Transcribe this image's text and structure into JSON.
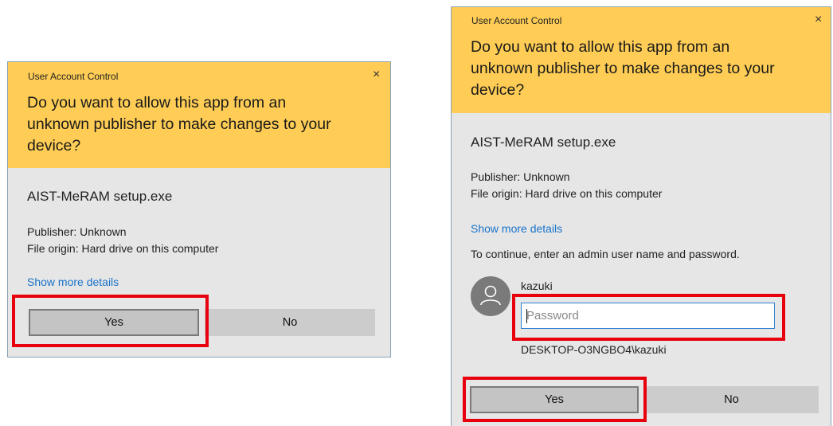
{
  "dialogs": [
    {
      "title": "User Account Control",
      "close_glyph": "×",
      "question_lines": [
        "Do you want to allow this app from an",
        "unknown publisher to make changes to your",
        "device?"
      ],
      "app_name": "AIST-MeRAM setup.exe",
      "publisher": "Publisher: Unknown",
      "file_origin": "File origin: Hard drive on this computer",
      "details_link": "Show more details",
      "yes_label": "Yes",
      "no_label": "No"
    },
    {
      "title": "User Account Control",
      "close_glyph": "×",
      "question_lines": [
        "Do you want to allow this app from an",
        "unknown publisher to make changes to your",
        "device?"
      ],
      "app_name": "AIST-MeRAM setup.exe",
      "publisher": "Publisher: Unknown",
      "file_origin": "File origin: Hard drive on this computer",
      "details_link": "Show more details",
      "instruction": "To continue, enter an admin user name and password.",
      "username": "kazuki",
      "password_placeholder": "Password",
      "account": "DESKTOP-O3NGBO4\\kazuki",
      "yes_label": "Yes",
      "no_label": "No"
    }
  ],
  "icons": {
    "avatar": "user-silhouette-icon",
    "close": "close-icon"
  },
  "colors": {
    "header": "#ffcd55",
    "body": "#e6e6e6",
    "highlight": "#e8000d",
    "link": "#1a73c9"
  }
}
